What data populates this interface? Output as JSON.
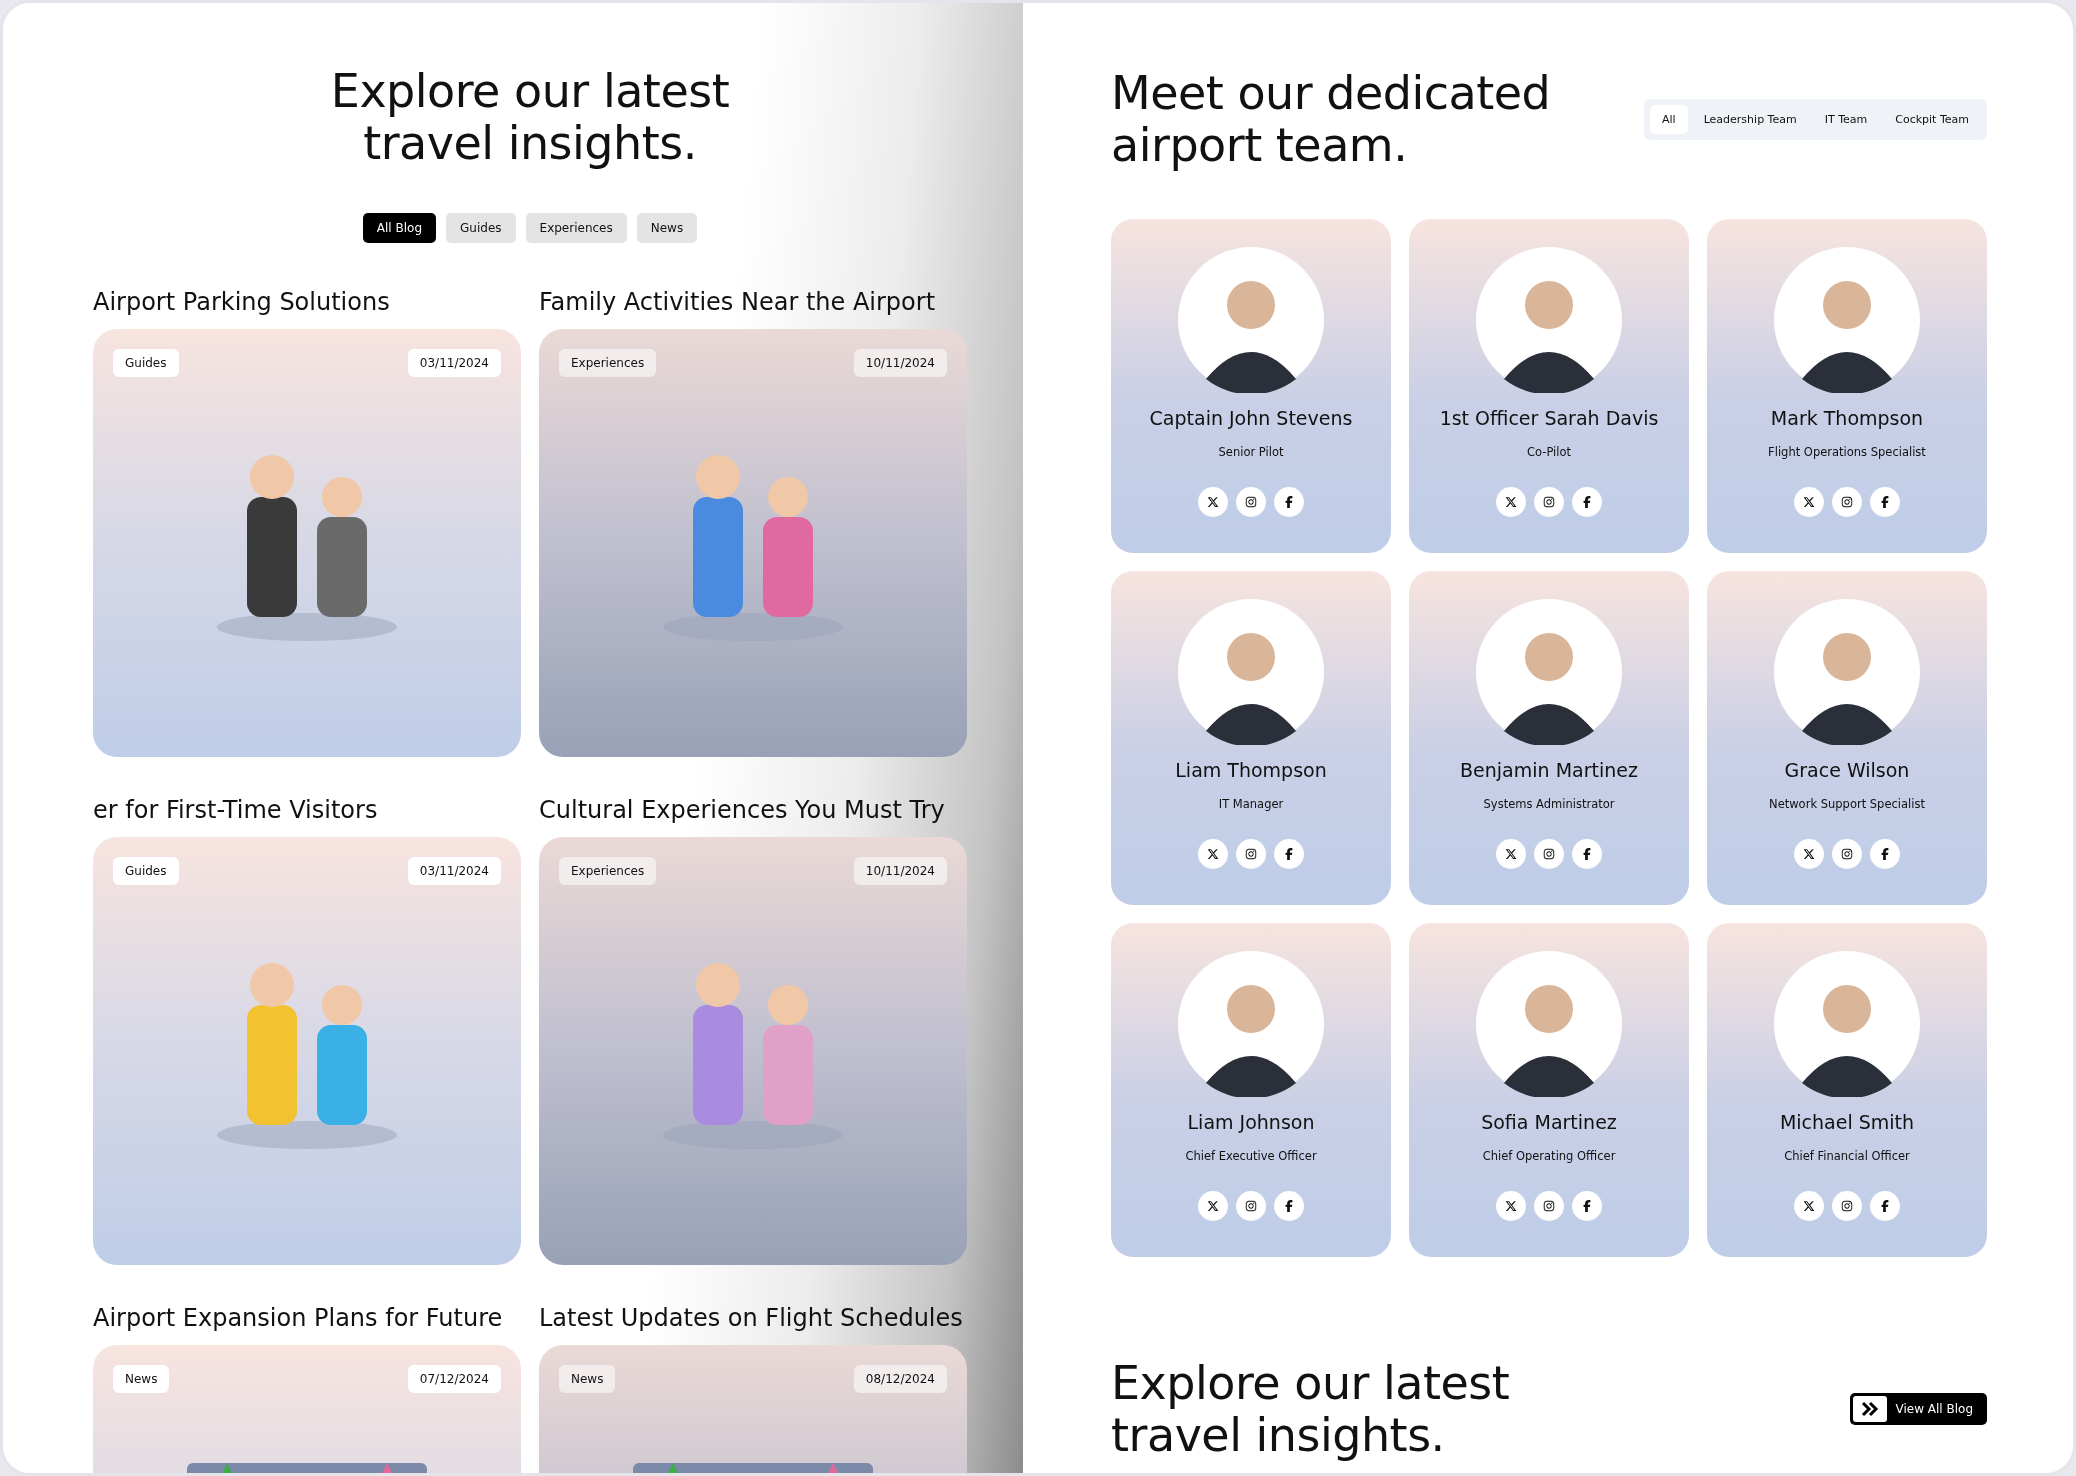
{
  "blog_page": {
    "heading": "Explore our latest travel insights.",
    "filters": [
      {
        "label": "All Blog",
        "selected": true
      },
      {
        "label": "Guides",
        "selected": false
      },
      {
        "label": "Experiences",
        "selected": false
      },
      {
        "label": "News",
        "selected": false
      }
    ],
    "posts": [
      {
        "title": "Airport Parking Solutions",
        "category": "Guides",
        "date": "03/11/2024"
      },
      {
        "title": "Family Activities Near the Airport",
        "category": "Experiences",
        "date": "10/11/2024"
      },
      {
        "title": "er for First-Time Visitors",
        "category": "Guides",
        "date": "03/11/2024"
      },
      {
        "title": "Cultural Experiences You Must Try",
        "category": "Experiences",
        "date": "10/11/2024"
      },
      {
        "title": "Airport Expansion Plans for Future",
        "category": "News",
        "date": "07/12/2024"
      },
      {
        "title": "Latest Updates on Flight Schedules",
        "category": "News",
        "date": "08/12/2024"
      }
    ]
  },
  "team_page": {
    "heading": "Meet our dedicated airport team.",
    "filters": [
      {
        "label": "All",
        "selected": true
      },
      {
        "label": "Leadership Team",
        "selected": false
      },
      {
        "label": "IT Team",
        "selected": false
      },
      {
        "label": "Cockpit Team",
        "selected": false
      }
    ],
    "members": [
      {
        "name": "Captain John Stevens",
        "role": "Senior Pilot"
      },
      {
        "name": "1st Officer Sarah Davis",
        "role": "Co-Pilot"
      },
      {
        "name": "Mark Thompson",
        "role": "Flight Operations Specialist"
      },
      {
        "name": "Liam Thompson",
        "role": "IT Manager"
      },
      {
        "name": "Benjamin Martinez",
        "role": "Systems Administrator"
      },
      {
        "name": "Grace Wilson",
        "role": "Network Support Specialist"
      },
      {
        "name": "Liam Johnson",
        "role": "Chief Executive Officer"
      },
      {
        "name": "Sofia Martinez",
        "role": "Chief Operating Officer"
      },
      {
        "name": "Michael Smith",
        "role": "Chief Financial Officer"
      }
    ],
    "footer": {
      "heading": "Explore our latest travel insights.",
      "button": "View All Blog"
    }
  }
}
